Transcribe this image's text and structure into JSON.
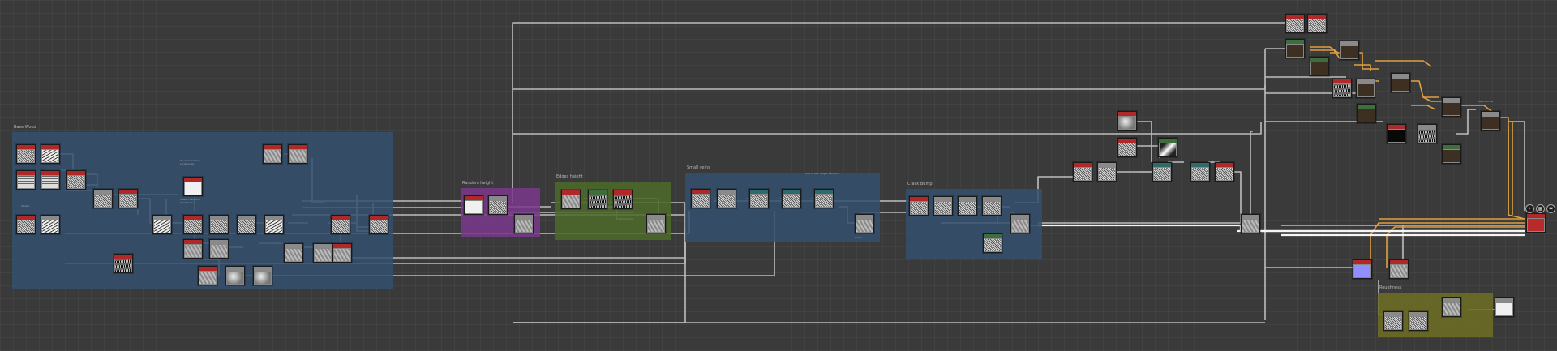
{
  "frames": [
    {
      "id": "base",
      "title": "Base Wood",
      "color": "#35506e"
    },
    {
      "id": "random",
      "title": "Random height",
      "color": "#7a3a8c"
    },
    {
      "id": "edges",
      "title": "Edges height",
      "color": "#4d6b2c"
    },
    {
      "id": "small-veins",
      "title": "Small veins",
      "color": "#35506e"
    },
    {
      "id": "crack",
      "title": "Crack Bump",
      "color": "#35506e"
    },
    {
      "id": "roughness",
      "title": "Roughness",
      "color": "#6e6e24"
    }
  ],
  "comments": [
    {
      "id": "c1",
      "text": "Overall Variation\nLarge scale"
    },
    {
      "id": "c2",
      "text": "Overall Variation\nSmall scale"
    },
    {
      "id": "c3",
      "text": "Veneer"
    },
    {
      "id": "c4",
      "text": "Add to vein height variation"
    },
    {
      "id": "c5",
      "text": "Crack"
    },
    {
      "id": "c6",
      "text": "Base Normal"
    }
  ],
  "output_icons": [
    "pin-icon",
    "checker-icon",
    "gear-icon"
  ],
  "colors": {
    "canvas_bg": "#3a3a3a",
    "wire_grey": "#bdbdbd",
    "wire_orange": "#e0a040",
    "wire_white": "#f2f2f2",
    "header_red": "#b02828",
    "header_green": "#3e6e3e",
    "header_teal": "#2f6b6b",
    "header_grey": "#8a8a8a"
  }
}
